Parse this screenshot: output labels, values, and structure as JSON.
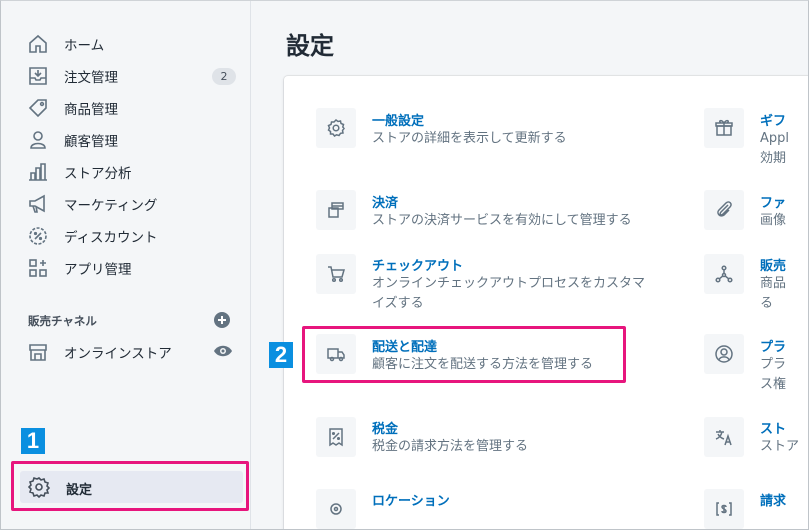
{
  "sidebar": {
    "items": [
      {
        "label": "ホーム",
        "icon": "home-icon"
      },
      {
        "label": "注文管理",
        "icon": "orders-icon",
        "badge": "2"
      },
      {
        "label": "商品管理",
        "icon": "tag-icon"
      },
      {
        "label": "顧客管理",
        "icon": "person-icon"
      },
      {
        "label": "ストア分析",
        "icon": "bar-chart-icon"
      },
      {
        "label": "マーケティング",
        "icon": "megaphone-icon"
      },
      {
        "label": "ディスカウント",
        "icon": "discount-icon"
      },
      {
        "label": "アプリ管理",
        "icon": "apps-icon"
      }
    ],
    "channels_title": "販売チャネル",
    "online_store": "オンラインストア",
    "settings": "設定"
  },
  "page": {
    "title": "設定"
  },
  "settings_left": [
    {
      "title": "一般設定",
      "desc": [
        "ストアの詳細を表示して更新する"
      ]
    },
    {
      "title": "決済",
      "desc": [
        "ストアの決済サービスを有効にして管理する"
      ]
    },
    {
      "title": "チェックアウト",
      "desc": [
        "オンラインチェックアウトプロセスをカスタマ",
        "イズする"
      ]
    },
    {
      "title": "配送と配達",
      "desc": [
        "顧客に注文を配送する方法を管理する"
      ]
    },
    {
      "title": "税金",
      "desc": [
        "税金の請求方法を管理する"
      ]
    },
    {
      "title": "ロケーション",
      "desc": []
    }
  ],
  "settings_right": [
    {
      "title": "ギフ",
      "desc": [
        "Appl",
        "効期"
      ]
    },
    {
      "title": "ファ",
      "desc": [
        "画像"
      ]
    },
    {
      "title": "販売",
      "desc": [
        "商品",
        "る"
      ]
    },
    {
      "title": "プラ",
      "desc": [
        "プラ",
        "ス権"
      ]
    },
    {
      "title": "スト",
      "desc": [
        "ストア"
      ]
    },
    {
      "title": "請求",
      "desc": []
    }
  ],
  "annotations": {
    "step1": "1",
    "step2": "2"
  },
  "colors": {
    "accent_link": "#006fbb",
    "highlight": "#e7157d",
    "step_badge": "#0a8fe0"
  }
}
